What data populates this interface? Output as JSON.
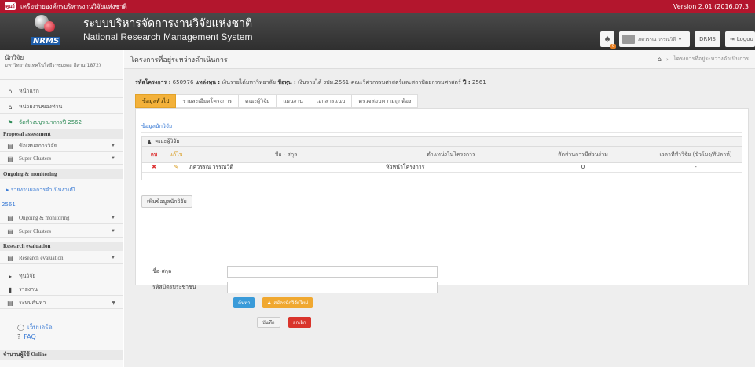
{
  "topbar": {
    "mini_logo": "ศูนย์",
    "site_name": "เครือข่ายองค์กรบริหารงานวิจัยแห่งชาติ",
    "version": "Version 2.01 (2016.07.3"
  },
  "header": {
    "logo_text": "NRMS",
    "title_th": "ระบบบริหารจัดการงานวิจัยแห่งชาติ",
    "title_en": "National Research Management System",
    "notify_count": "0",
    "user_label": "ภควรรณ วรรณวิดี",
    "drms_label": "DRMS",
    "logout_label": "Logou"
  },
  "sidebar": {
    "org_title": "นักวิจัย",
    "org_sub": "มหาวิทยาลัยเทคโนโลยีราชมงคล อีสาน(1872)",
    "items": [
      {
        "label": "หน้าแรก",
        "icon": "home-icon"
      },
      {
        "label": "หน่วยงานของท่าน",
        "icon": "home-icon"
      },
      {
        "label": "จัดทำงบบูรณาการปี 2562",
        "icon": "flag-icon"
      }
    ],
    "sections": {
      "proposal": "Proposal assessment",
      "ongoing": "Ongoing & monitoring",
      "research": "Research evaluation"
    },
    "proposal_items": [
      "ข้อเสนอการวิจัย",
      "Super Clusters"
    ],
    "ongoing_link": "▸ รายงานผลการดำเนินงานปี",
    "ongoing_year": "2561",
    "ongoing_items": [
      "Ongoing & monitoring",
      "Super Clusters"
    ],
    "research_items": [
      "Research evaluation",
      "ทุนวิจัย",
      "รายงาน",
      "ระบบค้นหา"
    ],
    "links": [
      "เว็บบอร์ด",
      "FAQ"
    ],
    "online": "จำนวนผู้ใช้ Online"
  },
  "main": {
    "page_title": "โครงการที่อยู่ระหว่างดำเนินการ",
    "breadcrumb": "โครงการที่อยู่ระหว่างดำเนินการ",
    "project_line": {
      "code_label": "รหัสโครงการ :",
      "code": "650976",
      "source_label": "แหล่งทุน :",
      "source": "เงินรายได้มหาวิทยาลัย",
      "fund_label": "ชื่อทุน :",
      "fund": "เงินรายได้ งปม.2561-คณะวิศวกรรมศาสตร์และสถาปัตยกรรมศาสตร์",
      "year_label": "ปี :",
      "year": "2561"
    },
    "tabs": [
      "ข้อมูลทั่วไป",
      "รายละเอียดโครงการ",
      "คณะผู้วิจัย",
      "แผนงาน",
      "เอกสารแนบ",
      "ตรวจสอบความถูกต้อง"
    ],
    "researcher_section": "ข้อมูลนักวิจัย",
    "table_caption": "คณะผู้วิจัย",
    "columns": [
      "ลบ",
      "แก้ไข",
      "ชื่อ - สกุล",
      "ตำแหน่งในโครงการ",
      "สัดส่วนการมีส่วนร่วม",
      "เวลาที่ทำวิจัย (ชั่วโมง/สัปดาห์)"
    ],
    "rows": [
      {
        "name": "ภควรรณ วรรณวิดี",
        "role": "หัวหน้าโครงการ",
        "pct": "0",
        "time": "-"
      }
    ],
    "add_button": "เพิ่มข้อมูลนักวิจัย",
    "form": {
      "name_label": "ชื่อ-สกุล",
      "id_label": "รหัสบัตรประชาชน",
      "search_button": "ค้นหา",
      "new_button": "สมัครนักวิจัยใหม่",
      "save_button": "บันทึก",
      "cancel_button": "ยกเลิก"
    }
  }
}
